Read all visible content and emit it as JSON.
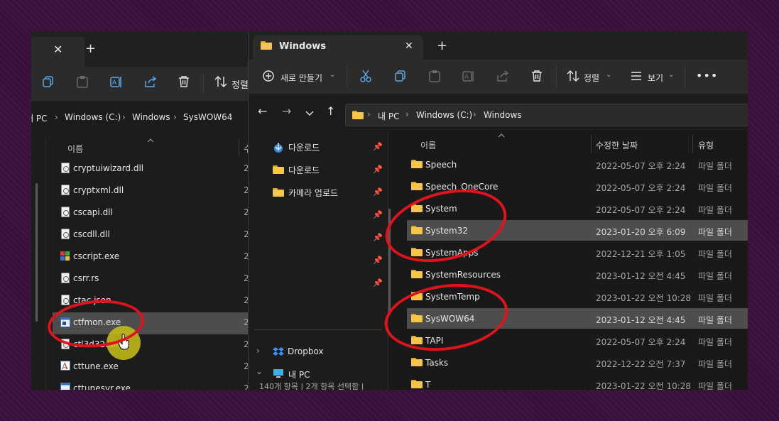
{
  "back_window": {
    "breadcrumb": [
      "내 PC",
      "Windows (C:)",
      "Windows",
      "SysWOW64"
    ],
    "toolbar": {
      "sort_label": "정렬"
    },
    "column_name": "이름",
    "column_date_partial": "수",
    "files": [
      {
        "name": "cryptuiwizard.dll",
        "date": "2",
        "icon": "dll-file-icon"
      },
      {
        "name": "cryptxml.dll",
        "date": "2",
        "icon": "dll-file-icon"
      },
      {
        "name": "cscapi.dll",
        "date": "2",
        "icon": "dll-file-icon"
      },
      {
        "name": "cscdll.dll",
        "date": "2",
        "icon": "dll-file-icon"
      },
      {
        "name": "cscript.exe",
        "date": "2",
        "icon": "script-exe-icon"
      },
      {
        "name": "csrr.rs",
        "date": "2",
        "icon": "generic-file-icon"
      },
      {
        "name": "ctac.json",
        "date": "2",
        "icon": "generic-file-icon"
      },
      {
        "name": "ctfmon.exe",
        "date": "2",
        "icon": "exe-file-icon",
        "selected": true
      },
      {
        "name": "ctl3d32.dll",
        "date": "2",
        "icon": "dll-file-icon"
      },
      {
        "name": "cttune.exe",
        "date": "2",
        "icon": "cttune-icon"
      },
      {
        "name": "cttunesvr.exe",
        "date": "2",
        "icon": "exe-file-icon"
      }
    ]
  },
  "front_window": {
    "tab_title": "Windows",
    "toolbar": {
      "new_label": "새로 만들기",
      "sort_label": "정렬",
      "view_label": "보기"
    },
    "address": [
      "내 PC",
      "Windows (C:)",
      "Windows"
    ],
    "sidebar": {
      "quick_items": [
        {
          "label": "다운로드",
          "icon": "download-icon"
        },
        {
          "label": "다운로드",
          "icon": "folder-icon"
        },
        {
          "label": "카메라 업로드",
          "icon": "folder-icon"
        }
      ],
      "dropbox_label": "Dropbox",
      "pc_label": "내 PC"
    },
    "columns": {
      "name": "이름",
      "date": "수정한 날짜",
      "type": "유형"
    },
    "rows": [
      {
        "name": "Speech",
        "date": "2022-05-07 오후 2:24",
        "type": "파일 폴더"
      },
      {
        "name": "Speech_OneCore",
        "date": "2022-05-07 오후 2:24",
        "type": "파일 폴더"
      },
      {
        "name": "System",
        "date": "2022-05-07 오후 2:24",
        "type": "파일 폴더"
      },
      {
        "name": "System32",
        "date": "2023-01-20 오후 6:09",
        "type": "파일 폴더",
        "selected": true
      },
      {
        "name": "SystemApps",
        "date": "2022-12-21 오후 1:05",
        "type": "파일 폴더"
      },
      {
        "name": "SystemResources",
        "date": "2023-01-12 오전 4:45",
        "type": "파일 폴더"
      },
      {
        "name": "SystemTemp",
        "date": "2023-01-22 오전 10:28",
        "type": "파일 폴더"
      },
      {
        "name": "SysWOW64",
        "date": "2023-01-12 오전 4:45",
        "type": "파일 폴더",
        "selected": true
      },
      {
        "name": "TAPI",
        "date": "2022-05-07 오후 2:24",
        "type": "파일 폴더"
      },
      {
        "name": "Tasks",
        "date": "2022-12-22 오전 7:37",
        "type": "파일 폴더"
      },
      {
        "name": "T",
        "date": "2023-01-22 오전 10:28",
        "type": "파일 폴더"
      }
    ],
    "status_bar": "140개 항목 | 2개 항목 선택함 |"
  },
  "colors": {
    "window_bg": "#1c1c1c",
    "selection": "#4d4d4d",
    "annotation_red": "#e0131b",
    "cursor_highlight": "#c9c21a",
    "folder_yellow": "#f6c644"
  }
}
